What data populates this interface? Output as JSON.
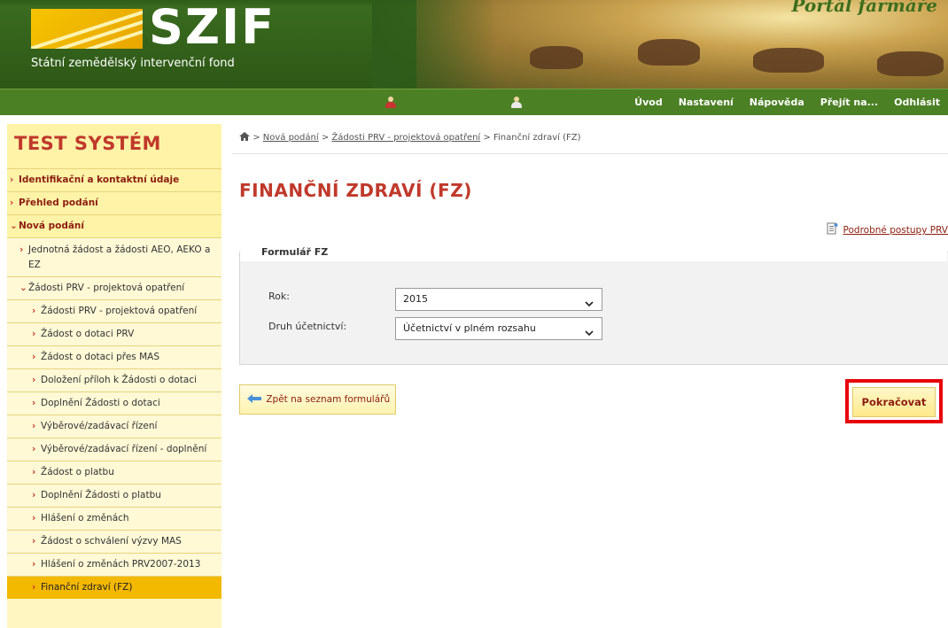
{
  "header": {
    "logo_text": "SZIF",
    "logo_subtitle": "Státní zemědělský intervenční fond",
    "portal_title": "Portál farmáře"
  },
  "nav": {
    "items": [
      {
        "label": "Úvod"
      },
      {
        "label": "Nastavení"
      },
      {
        "label": "Nápověda"
      },
      {
        "label": "Přejít na..."
      },
      {
        "label": "Odhlásit"
      }
    ]
  },
  "sidebar": {
    "title": "TEST SYSTÉM",
    "items": [
      {
        "label": "Identifikační a kontaktní údaje",
        "level": 0,
        "expanded": false
      },
      {
        "label": "Přehled podání",
        "level": 0,
        "expanded": false
      },
      {
        "label": "Nová podání",
        "level": 0,
        "expanded": true
      },
      {
        "label": "Jednotná žádost a žádosti AEO, AEKO a EZ",
        "level": 1,
        "expanded": false
      },
      {
        "label": "Žádosti PRV - projektová opatření",
        "level": 1,
        "expanded": true
      },
      {
        "label": "Žádosti PRV - projektová opatření",
        "level": 2
      },
      {
        "label": "Žádost o dotaci PRV",
        "level": 2
      },
      {
        "label": "Žádost o dotaci přes MAS",
        "level": 2
      },
      {
        "label": "Doložení příloh k Žádosti o dotaci",
        "level": 2
      },
      {
        "label": "Doplnění Žádosti o dotaci",
        "level": 2
      },
      {
        "label": "Výběrové/zadávací řízení",
        "level": 2
      },
      {
        "label": "Výběrové/zadávací řízení - doplnění",
        "level": 2
      },
      {
        "label": "Žádost o platbu",
        "level": 2
      },
      {
        "label": "Doplnění Žádosti o platbu",
        "level": 2
      },
      {
        "label": "Hlášení o změnách",
        "level": 2
      },
      {
        "label": "Žádost o schválení výzvy MAS",
        "level": 2
      },
      {
        "label": "Hlášení o změnách PRV2007-2013",
        "level": 2
      },
      {
        "label": "Finanční zdraví (FZ)",
        "level": 2,
        "active": true
      }
    ]
  },
  "breadcrumb": {
    "separator": ">",
    "items": [
      "Nová podání",
      "Žádosti PRV - projektová opatření"
    ],
    "current": "Finanční zdraví (FZ)"
  },
  "page": {
    "title": "FINANČNÍ ZDRAVÍ (FZ)",
    "guide_link": "Podrobné postupy PRV"
  },
  "form": {
    "legend": "Formulář FZ",
    "year_label": "Rok:",
    "year_value": "2015",
    "accounting_label": "Druh účetnictví:",
    "accounting_value": "Účetnictví v plném rozsahu"
  },
  "actions": {
    "back_label": "Zpět na seznam formulářů",
    "continue_label": "Pokračovat"
  },
  "colors": {
    "accent_red": "#c0392b",
    "nav_green": "#4b8024",
    "sidebar_yellow": "#fff6c2",
    "active_item": "#f3b800",
    "highlight": "#e8000b"
  }
}
